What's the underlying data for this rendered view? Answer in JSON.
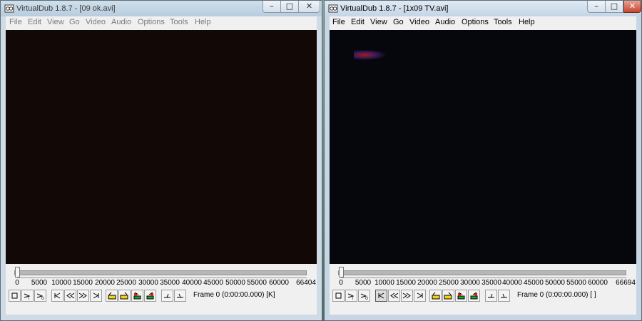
{
  "windows": [
    {
      "title": "VirtualDub 1.8.7 - [09 ok.avi]",
      "menu": [
        "File",
        "Edit",
        "View",
        "Go",
        "Video",
        "Audio",
        "Options",
        "Tools",
        "Help"
      ],
      "ticks": [
        "0",
        "5000",
        "10000",
        "15000",
        "20000",
        "25000",
        "30000",
        "35000",
        "40000",
        "45000",
        "50000",
        "55000",
        "60000",
        "66404"
      ],
      "frame_status": "Frame 0 (0:00:00.000) [K]",
      "controls": {
        "minimize": "–",
        "maximize": "□",
        "close": "✕"
      }
    },
    {
      "title": "VirtualDub 1.8.7 - [1x09 TV.avi]",
      "menu": [
        "File",
        "Edit",
        "View",
        "Go",
        "Video",
        "Audio",
        "Options",
        "Tools",
        "Help"
      ],
      "ticks": [
        "0",
        "5000",
        "10000",
        "15000",
        "20000",
        "25000",
        "30000",
        "35000",
        "40000",
        "45000",
        "50000",
        "55000",
        "60000",
        "66694"
      ],
      "frame_status": "Frame 0 (0:00:00.000) [ ]",
      "controls": {
        "minimize": "–",
        "maximize": "□",
        "close": "✕"
      }
    }
  ],
  "colors": {
    "accent_close": "#c9452f",
    "video_left": "#120806",
    "video_right": "#06070c",
    "keyframe_yellow": "#f2d21b",
    "keyframe_green": "#2aa52a",
    "keyframe_red": "#d42020"
  },
  "toolbar_icons": [
    "stop-icon",
    "play-input-icon",
    "play-output-icon",
    "go-start-icon",
    "step-back-icon",
    "step-forward-icon",
    "go-end-icon",
    "prev-keyframe-icon",
    "next-keyframe-icon",
    "prev-scene-icon",
    "next-scene-icon",
    "mark-in-icon",
    "mark-out-icon"
  ]
}
